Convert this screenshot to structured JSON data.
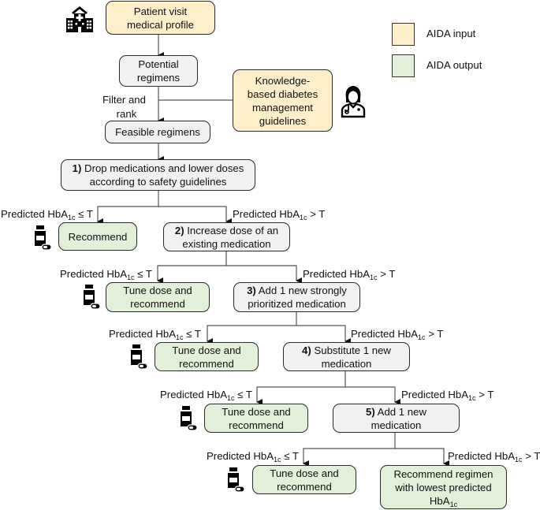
{
  "legend": {
    "items": [
      {
        "label": "AIDA input",
        "color": "#fdefc9"
      },
      {
        "label": "AIDA output",
        "color": "#e2efd9"
      }
    ]
  },
  "colors": {
    "input": "#fdefc9",
    "output": "#e2efd9",
    "step": "#f1f1f1",
    "line": "#555555"
  },
  "nodes": {
    "patient_visit": {
      "line1": "Patient visit",
      "line2": "medical profile"
    },
    "potential": {
      "line1": "Potential",
      "line2": "regimens"
    },
    "guidelines": {
      "line1": "Knowledge-",
      "line2": "based diabetes",
      "line3": "management",
      "line4": "guidelines"
    },
    "filter_label": {
      "line1": "Filter and",
      "line2": "rank"
    },
    "feasible": {
      "text": "Feasible regimens"
    },
    "step1": {
      "num": "1)",
      "line1": " Drop medications and lower doses",
      "line2": "according to safety guidelines"
    },
    "step2": {
      "num": "2)",
      "line1": " Increase dose of an",
      "line2": "existing medication"
    },
    "step3": {
      "num": "3)",
      "line1": " Add 1 new strongly",
      "line2": "prioritized medication"
    },
    "step4": {
      "num": "4)",
      "line1": " Substitute 1 new",
      "line2": "medication"
    },
    "step5": {
      "num": "5)",
      "line1": " Add 1 new",
      "line2": "medication"
    },
    "recommend": {
      "text": "Recommend"
    },
    "tune": {
      "line1": "Tune dose and",
      "line2": "recommend"
    },
    "final": {
      "line1": "Recommend regimen",
      "line2": "with lowest predicted",
      "line3": "HbA",
      "line3_sub": "1c"
    }
  },
  "branch": {
    "prefix": "Predicted HbA",
    "sub": "1c",
    "le": " ≤ T",
    "gt": " > T"
  },
  "icons": [
    "hospital-icon",
    "doctor-icon",
    "medication-bottle-icon"
  ]
}
